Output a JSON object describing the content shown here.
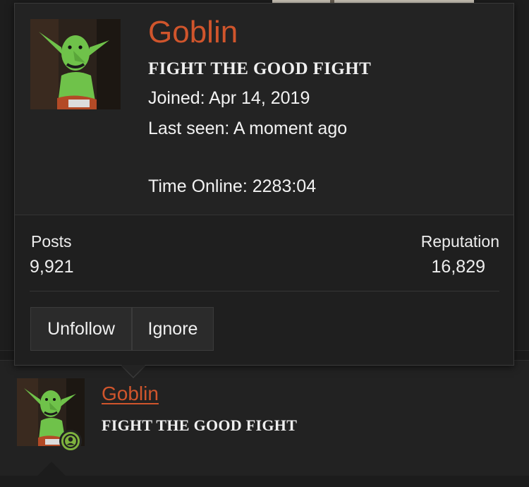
{
  "profile": {
    "username": "Goblin",
    "user_title": "FIGHT THE GOOD FIGHT",
    "joined": "Joined: Apr 14, 2019",
    "last_seen": "Last seen: A moment ago",
    "time_online": "Time Online: 2283:04",
    "stats": {
      "posts_label": "Posts",
      "posts_value": "9,921",
      "reputation_label": "Reputation",
      "reputation_value": "16,829"
    },
    "actions": {
      "unfollow_label": "Unfollow",
      "ignore_label": "Ignore"
    }
  },
  "post": {
    "username": "Goblin",
    "user_title": "FIGHT THE GOOD FIGHT",
    "online_icon": "user-online-icon"
  },
  "colors": {
    "username_accent": "#d0552c",
    "online_badge": "#7fb33e",
    "card_background": "#232323",
    "page_background": "#1b1b1b"
  }
}
